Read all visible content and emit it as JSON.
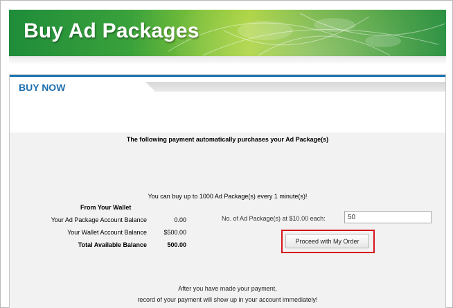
{
  "banner": {
    "title": "Buy Ad Packages"
  },
  "section": {
    "title": "BUY NOW"
  },
  "notice": "The following payment automatically purchases your Ad Package(s)",
  "limit": "You can buy up to 1000 Ad Package(s) every 1 minute(s)!",
  "wallet": {
    "header": "From Your Wallet",
    "rows": [
      {
        "label": "Your Ad Package Account Balance",
        "value": "0.00"
      },
      {
        "label": "Your Wallet Account Balance",
        "value": "$500.00"
      },
      {
        "label": "Total Available Balance",
        "value": "500.00"
      }
    ]
  },
  "order": {
    "quantity_label": "No. of Ad Package(s) at $10.00 each:",
    "quantity_value": "50",
    "proceed_label": "Proceed with My Order"
  },
  "after": {
    "line1": "After you have made your payment,",
    "line2": "record of your payment will show up in your account immediately!"
  },
  "colors": {
    "accent_blue": "#1f6fae",
    "highlight_red": "#d6141c",
    "banner_green": "#3aa23b"
  }
}
